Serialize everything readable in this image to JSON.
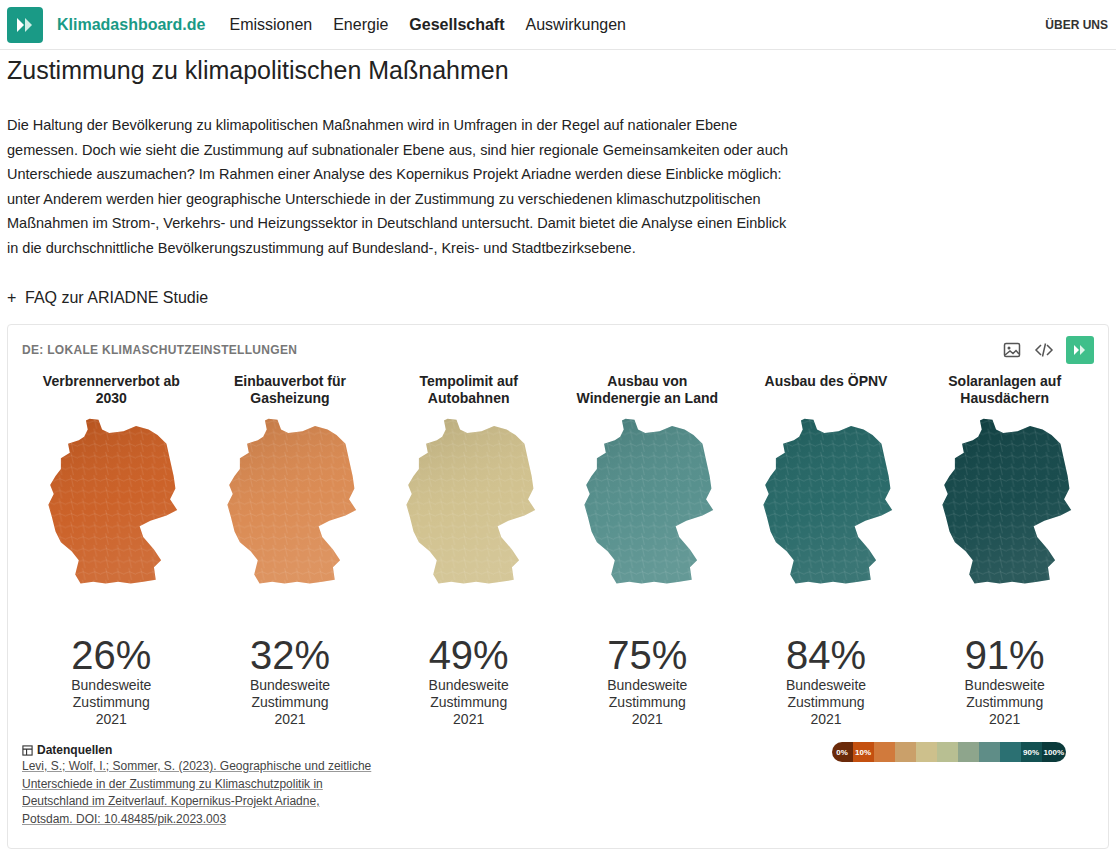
{
  "header": {
    "brand": "Klimadashboard.de",
    "nav": [
      {
        "label": "Emissionen",
        "selected": false
      },
      {
        "label": "Energie",
        "selected": false
      },
      {
        "label": "Gesellschaft",
        "selected": true
      },
      {
        "label": "Auswirkungen",
        "selected": false
      }
    ],
    "about": "ÜBER UNS"
  },
  "title": "Zustimmung zu klimapolitischen Maßnahmen",
  "intro": "Die Haltung der Bevölkerung zu klimapolitischen Maßnahmen wird in Umfragen in der Regel auf nationaler Ebene gemessen. Doch wie sieht die Zustimmung auf subnationaler Ebene aus, sind hier regionale Gemeinsamkeiten oder auch Unterschiede auszumachen? Im Rahmen einer Analyse des Kopernikus Projekt Ariadne werden diese Einblicke möglich: unter Anderem werden hier geographische Unterschiede in der Zustimmung zu verschiedenen klimaschutzpolitischen Maßnahmen im Strom-, Verkehrs- und Heizungssektor in Deutschland untersucht. Damit bietet die Analyse einen Einblick in die durchschnittliche Bevölkerungszustimmung auf Bundesland-, Kreis- und Stadtbezirksebene.",
  "faq": {
    "icon": "+",
    "label": "FAQ zur ARIADNE Studie"
  },
  "chart": {
    "title": "DE: LOKALE KLIMASCHUTZEINSTELLUNGEN",
    "maps": [
      {
        "title": "Verbrennerverbot ab 2030",
        "value": "26%",
        "label": "Bundesweite Zustimmung",
        "year": "2021",
        "color": "#c95a1e"
      },
      {
        "title": "Einbauverbot für Gasheizung",
        "value": "32%",
        "label": "Bundesweite Zustimmung",
        "year": "2021",
        "color": "#d9864c"
      },
      {
        "title": "Tempolimit auf Autobahnen",
        "value": "49%",
        "label": "Bundesweite Zustimmung",
        "year": "2021",
        "color": "#cfbf8a"
      },
      {
        "title": "Ausbau von Windenergie an Land",
        "value": "75%",
        "label": "Bundesweite Zustimmung",
        "year": "2021",
        "color": "#4f8b88"
      },
      {
        "title": "Ausbau des ÖPNV",
        "value": "84%",
        "label": "Bundesweite Zustimmung",
        "year": "2021",
        "color": "#1f6362"
      },
      {
        "title": "Solaranlagen auf Hausdächern",
        "value": "91%",
        "label": "Bundesweite Zustimmung",
        "year": "2021",
        "color": "#0e4345"
      }
    ],
    "sources": {
      "heading": "Datenquellen",
      "citation": "Levi, S.; Wolf, I.; Sommer, S. (2023). Geographische und zeitliche Unterschiede in der Zustimmung zu Klimaschutzpolitik in Deutschland im Zeitverlauf. Kopernikus-Projekt Ariadne, Potsdam. DOI: 10.48485/pik.2023.003"
    },
    "legend": [
      {
        "label": "0%",
        "color": "#6b2a0a"
      },
      {
        "label": "10%",
        "color": "#c4500f"
      },
      {
        "label": "",
        "color": "#d17a3c"
      },
      {
        "label": "",
        "color": "#caa06a"
      },
      {
        "label": "",
        "color": "#cdc08c"
      },
      {
        "label": "",
        "color": "#b8bf92"
      },
      {
        "label": "",
        "color": "#8ea58c"
      },
      {
        "label": "",
        "color": "#5f8d87"
      },
      {
        "label": "",
        "color": "#2b7072"
      },
      {
        "label": "90%",
        "color": "#135152"
      },
      {
        "label": "100%",
        "color": "#0b3a3b"
      }
    ]
  }
}
